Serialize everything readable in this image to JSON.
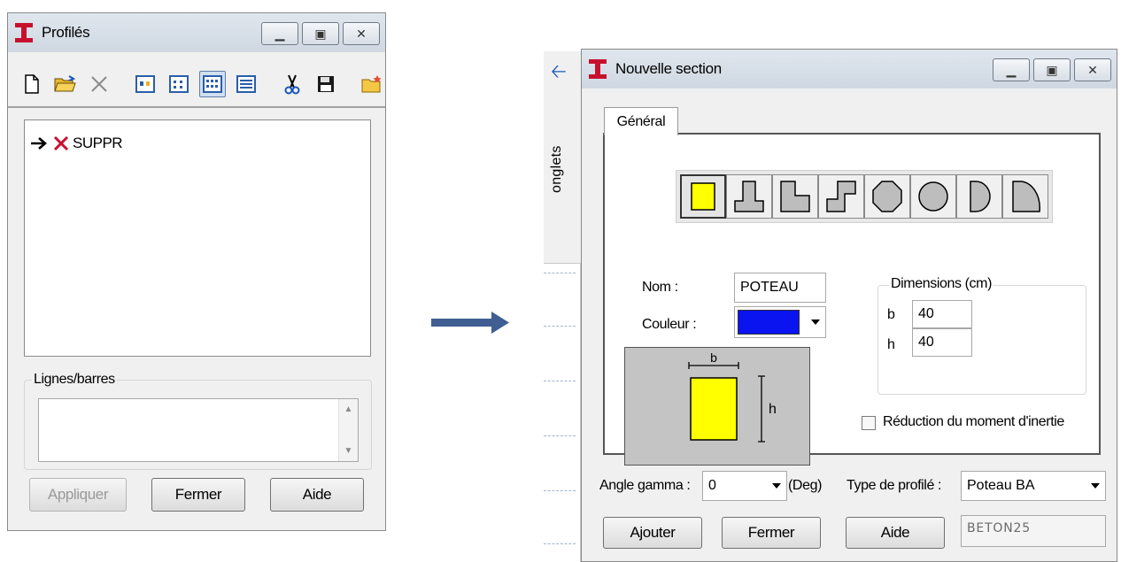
{
  "profiles": {
    "title": "Profilés",
    "tree_item": "SUPPR",
    "group_title": "Lignes/barres",
    "buttons": {
      "apply": "Appliquer",
      "close": "Fermer",
      "help": "Aide"
    }
  },
  "side": {
    "tab_label": "onglets"
  },
  "section": {
    "title": "Nouvelle section",
    "tab": "Général",
    "name_label": "Nom :",
    "name_value": "POTEAU",
    "color_label": "Couleur :",
    "color_value": "#0a14f0",
    "dimensions_title": "Dimensions (cm)",
    "b_label": "b",
    "b_value": "40",
    "h_label": "h",
    "h_value": "40",
    "preview_b": "b",
    "preview_h": "h",
    "inertia_label": "Réduction du moment d'inertie",
    "angle_label": "Angle gamma :",
    "angle_value": "0",
    "angle_unit": "(Deg)",
    "type_label": "Type de profilé :",
    "type_value": "Poteau BA",
    "material_value": "BETON25",
    "buttons": {
      "add": "Ajouter",
      "close": "Fermer",
      "help": "Aide"
    }
  },
  "colors": {
    "shape_fill": "#ffff00",
    "accent_blue": "#1a57b8",
    "delete_red": "#c8102e"
  }
}
